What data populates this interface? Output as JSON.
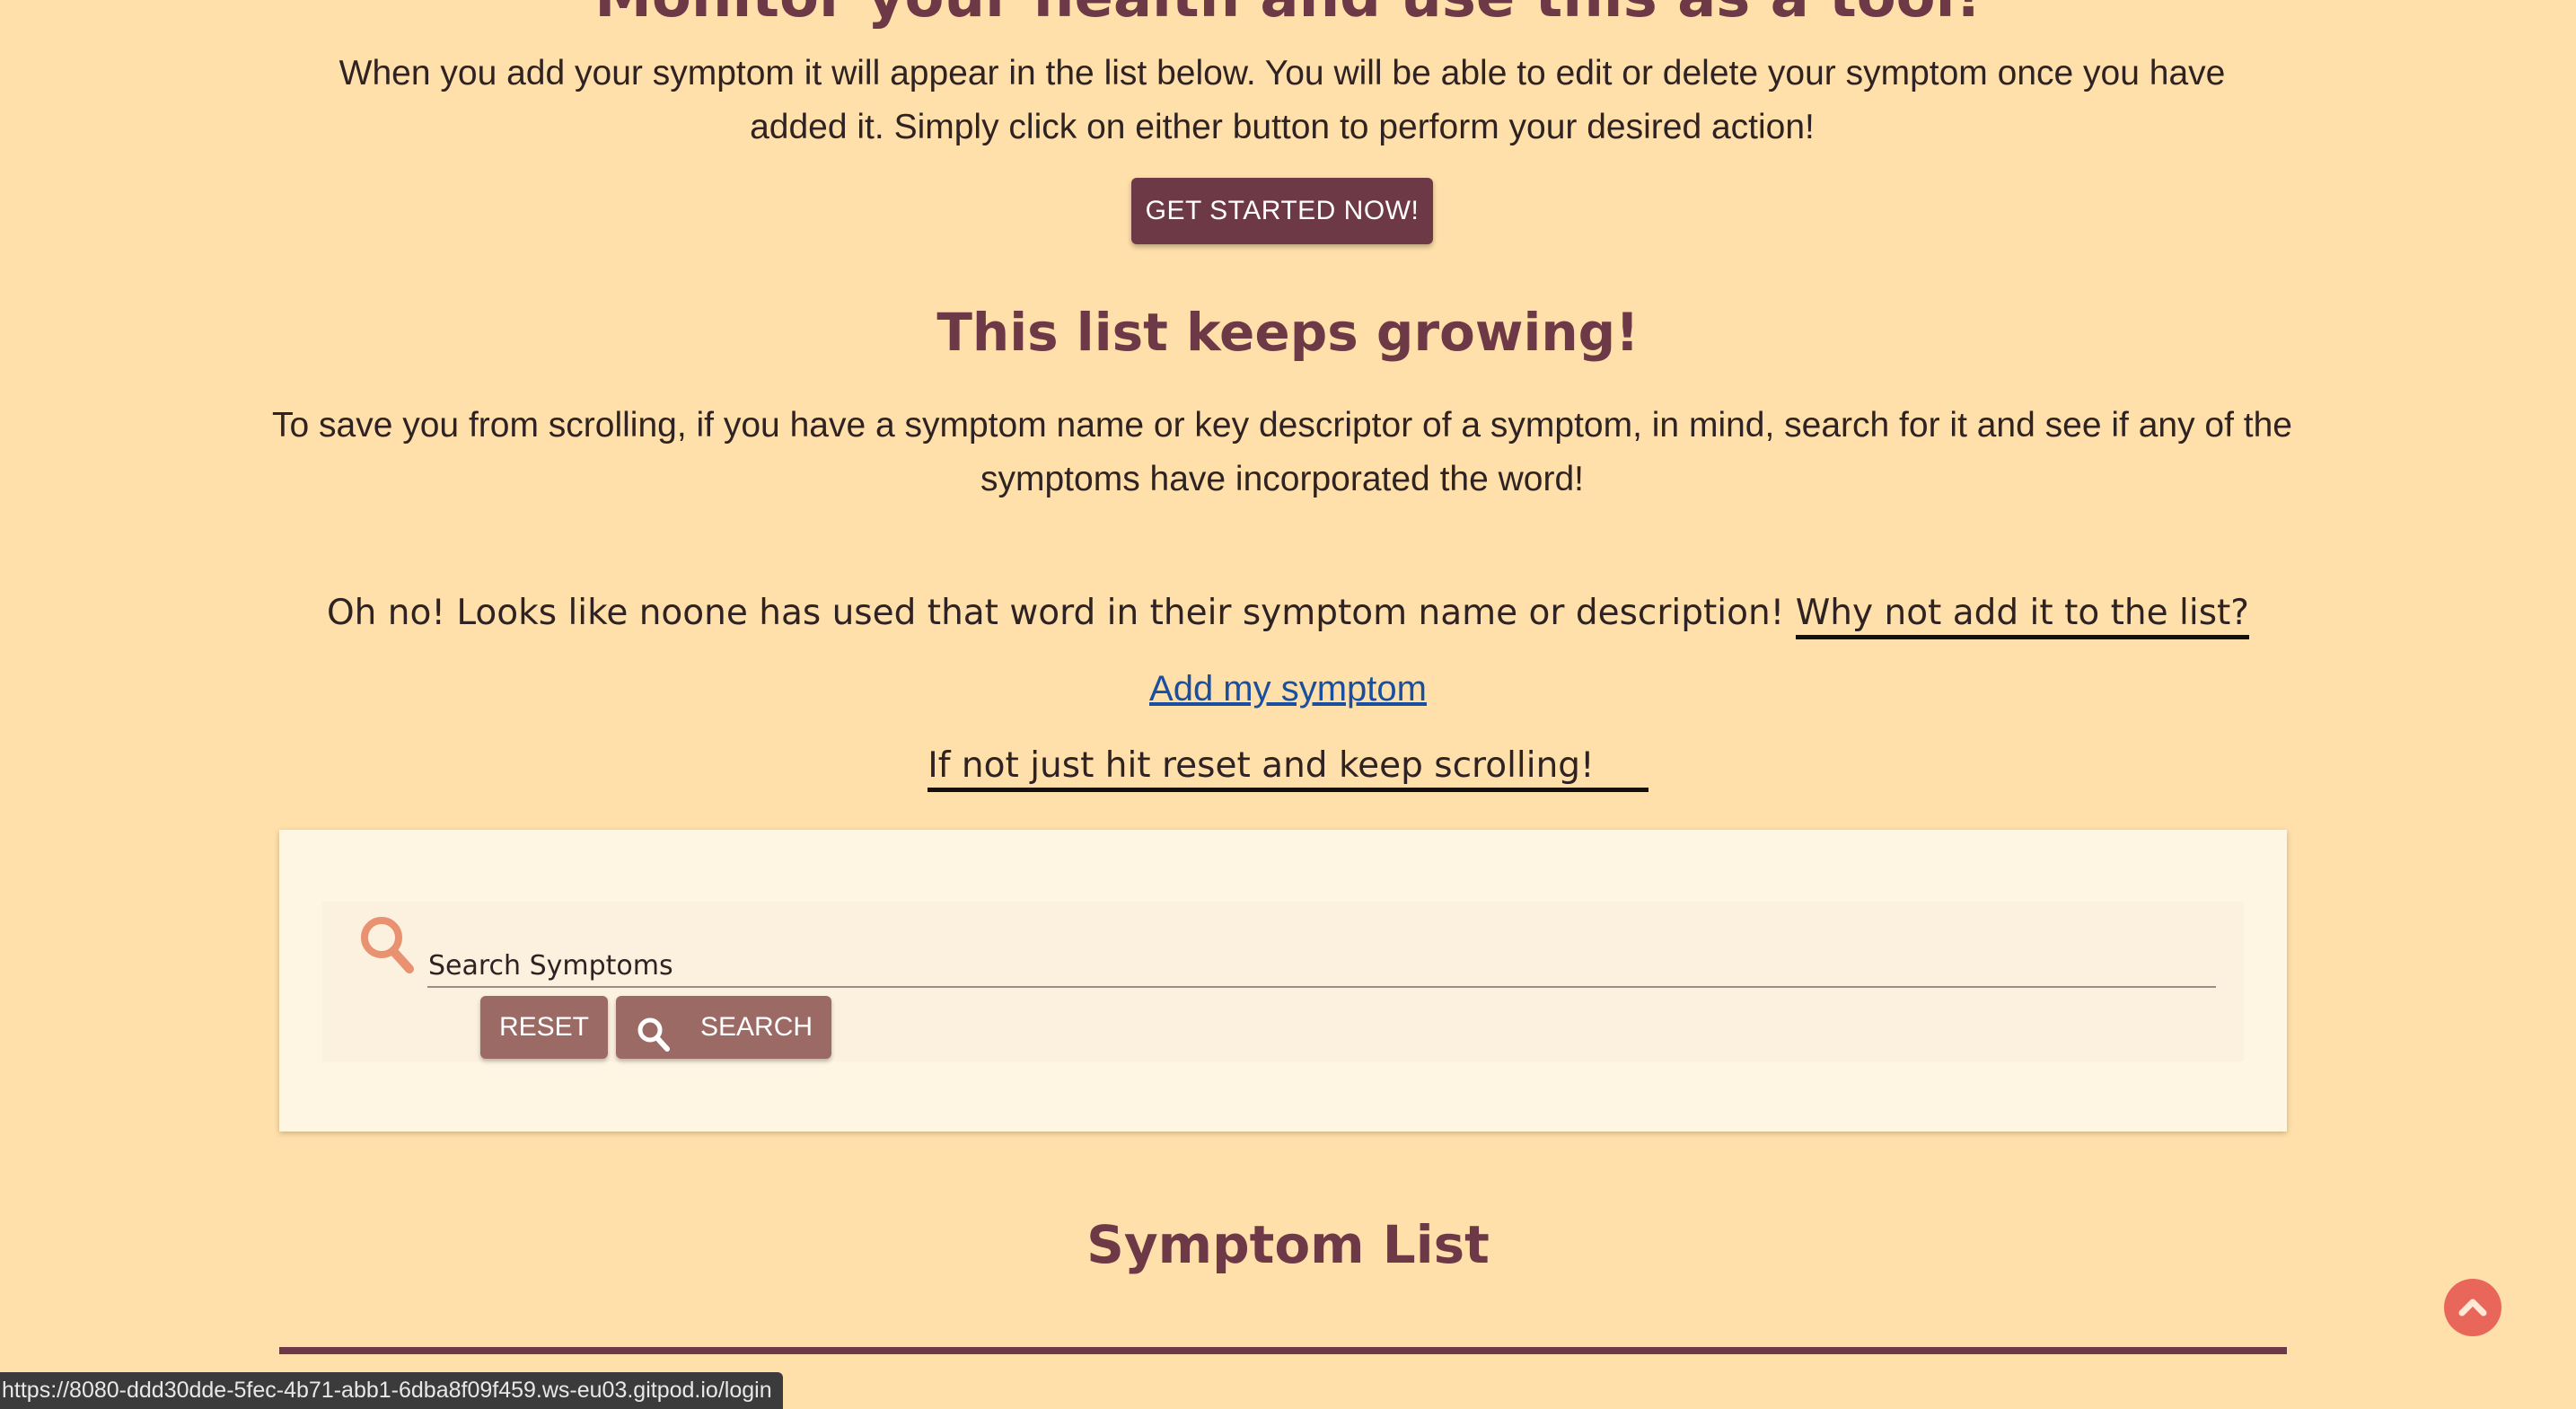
{
  "header": {
    "cut_heading": "Monitor your health and use this as a tool!",
    "intro_text": "When you add your symptom it will appear in the list below. You will be able to edit or delete your symptom once you have added it. Simply click on either button to perform your desired action!",
    "cta_label": "GET STARTED NOW!"
  },
  "search_section": {
    "heading": "This list keeps growing!",
    "intro_text": "To save you from scrolling, if you have a symptom name or key descriptor of a symptom, in mind, search for it and see if any of the symptoms have incorporated the word!",
    "no_result_text": "Oh no! Looks like noone has used that word in their symptom name or description!",
    "no_result_suggestion": "Why not add it to the list?",
    "add_link_label": "Add my symptom",
    "reset_hint": "If not just hit reset and keep scrolling!",
    "search_label": "Search Symptoms",
    "search_value": "",
    "reset_label": "RESET",
    "search_button_label": "SEARCH",
    "icons": [
      "search-icon",
      "search-icon"
    ]
  },
  "symptom_list": {
    "heading": "Symptom List"
  },
  "back_to_top": {
    "icon": "chevron-up-icon"
  },
  "status_bar": {
    "url": "https://8080-ddd30dde-5fec-4b71-abb1-6dba8f09f459.ws-eu03.gitpod.io/login"
  },
  "colors": {
    "background": "#ffe0aa",
    "brand": "#6e3947",
    "button_secondary": "#9c6a65",
    "accent": "#e8675a",
    "link": "#1a4fa0"
  }
}
